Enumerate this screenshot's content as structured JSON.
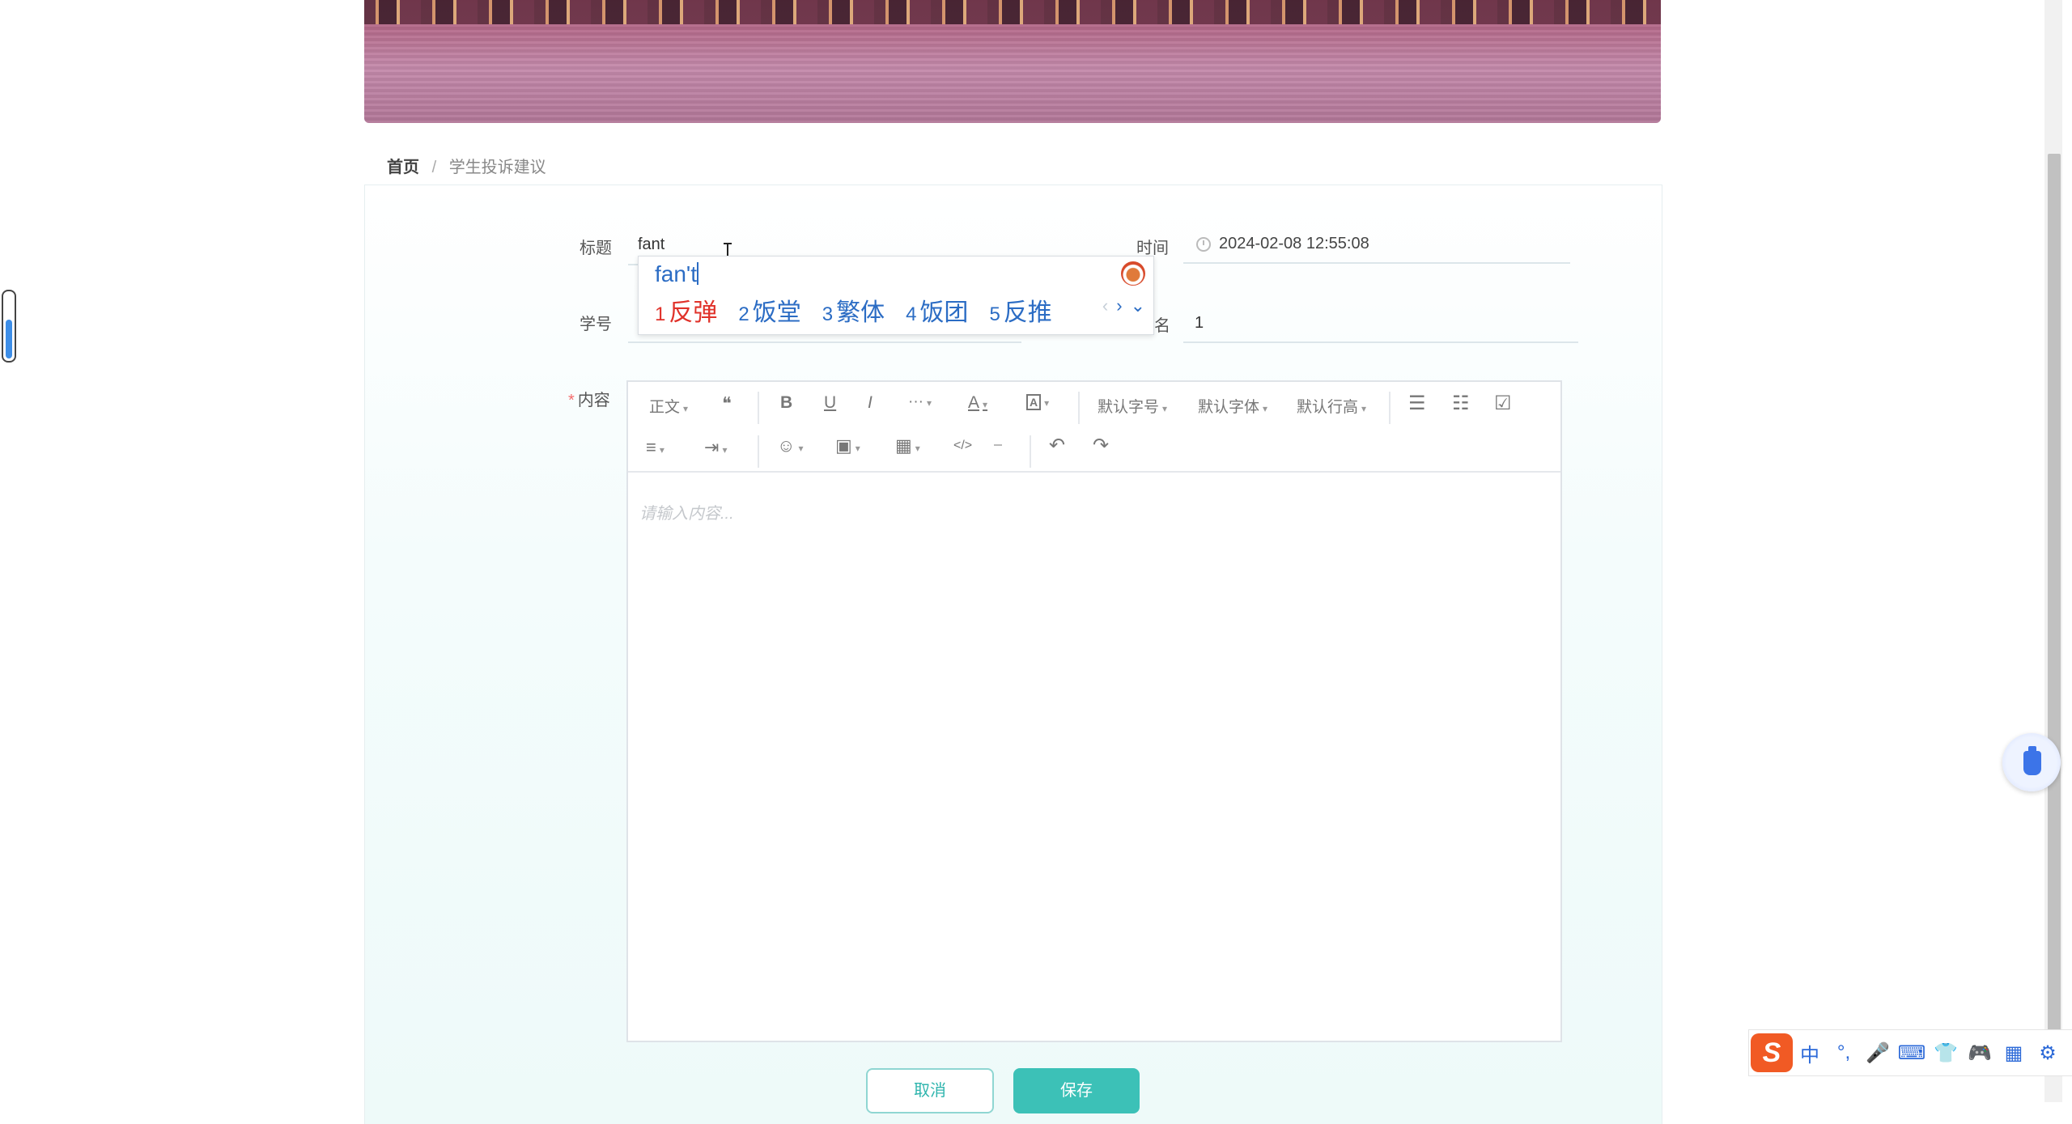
{
  "breadcrumb": {
    "home": "首页",
    "separator": "/",
    "current": "学生投诉建议"
  },
  "form": {
    "title_label": "标题",
    "title_value": "fant",
    "time_label": "时间",
    "time_value": "2024-02-08 12:55:08",
    "student_id_label": "学号",
    "name_label_visible": "名",
    "name_value": "1",
    "content_label": "内容",
    "required_mark": "*"
  },
  "ime_popup": {
    "pinyin": "fan't",
    "candidates": [
      {
        "num": "1",
        "text": "反弹"
      },
      {
        "num": "2",
        "text": "饭堂"
      },
      {
        "num": "3",
        "text": "繁体"
      },
      {
        "num": "4",
        "text": "饭团"
      },
      {
        "num": "5",
        "text": "反推"
      }
    ],
    "prev": "‹",
    "next": "›",
    "expand": "⌄"
  },
  "editor": {
    "toolbar": {
      "paragraph": "正文",
      "quote": "❝",
      "bold": "B",
      "underline": "U",
      "italic": "I",
      "more": "···",
      "font_color": "A",
      "bg_color": "A",
      "font_size": "默认字号",
      "font_family": "默认字体",
      "line_height": "默认行高",
      "bullet_list": "☰",
      "numbered_list": "☷",
      "todo": "☑",
      "align": "≡",
      "indent": "⇥",
      "emoji": "☺",
      "image": "▣",
      "table": "▦",
      "code": "</>",
      "divider": "⎯",
      "undo": "↶",
      "redo": "↷",
      "dropdown": "▾"
    },
    "placeholder": "请输入内容..."
  },
  "buttons": {
    "cancel": "取消",
    "save": "保存"
  },
  "ime_status_bar": {
    "logo": "S",
    "items": [
      "中",
      "°,",
      "🎤",
      "⌨",
      "👕",
      "🎮",
      "▦",
      "⚙"
    ]
  },
  "colors": {
    "accent": "#3cc1b7",
    "required": "#f56c6c",
    "ime_blue": "#2b6cc4",
    "ime_red": "#e0322a",
    "sogou_orange": "#f15a24"
  }
}
